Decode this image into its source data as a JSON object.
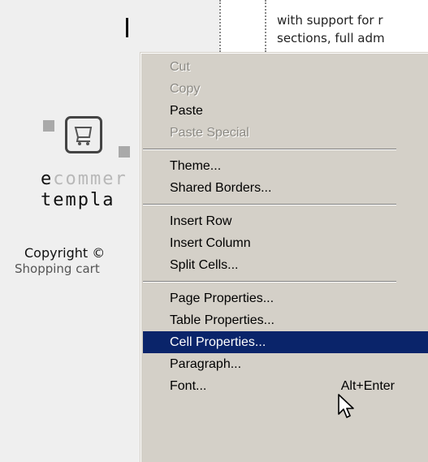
{
  "page": {
    "text_line1": "with support for r",
    "text_line2": "sections, full adm",
    "logo_word1_dark": "e",
    "logo_word1_light": "commer",
    "logo_word2_dark": "templa",
    "copyright": "Copyright ©",
    "shopping_cart": "Shopping cart"
  },
  "menu": {
    "items": [
      {
        "label": "Cut",
        "disabled": true
      },
      {
        "label": "Copy",
        "disabled": true
      },
      {
        "label": "Paste",
        "disabled": false
      },
      {
        "label": "Paste Special",
        "disabled": true
      },
      {
        "label": "Theme...",
        "disabled": false
      },
      {
        "label": "Shared Borders...",
        "disabled": false
      },
      {
        "label": "Insert Row",
        "disabled": false
      },
      {
        "label": "Insert Column",
        "disabled": false
      },
      {
        "label": "Split Cells...",
        "disabled": false
      },
      {
        "label": "Page Properties...",
        "disabled": false
      },
      {
        "label": "Table Properties...",
        "disabled": false
      },
      {
        "label": "Cell Properties...",
        "disabled": false,
        "highlighted": true
      },
      {
        "label": "Paragraph...",
        "disabled": false
      },
      {
        "label": "Font...",
        "disabled": false,
        "shortcut": "Alt+Enter"
      }
    ]
  },
  "colors": {
    "menu_bg": "#d4d0c8",
    "highlight": "#0a246a",
    "disabled_text": "#8c8a84"
  },
  "icons": {
    "logo": "shopping-cart-icon",
    "pointer": "mouse-pointer-icon"
  }
}
